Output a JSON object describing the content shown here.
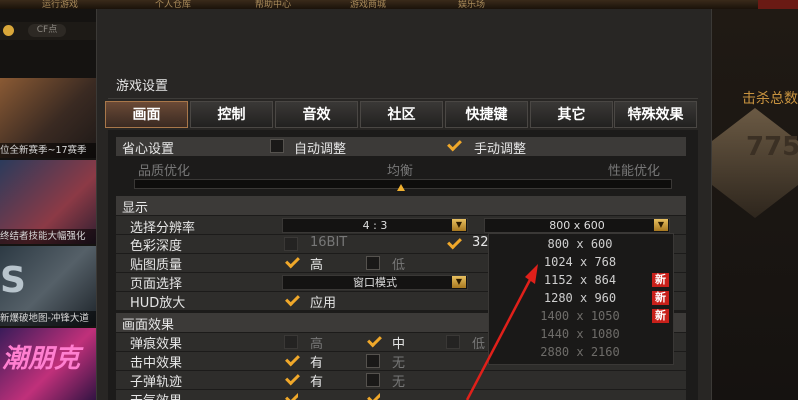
{
  "colors": {
    "accent": "#f0a82a",
    "new_badge": "#c8201a",
    "arrow": "#e0201a"
  },
  "background": {
    "top_menu": [
      "运行游戏",
      "个人仓库",
      "帮助中心",
      "游戏商城",
      "娱乐场"
    ],
    "cf_points": "CF点",
    "promos": [
      "位全新赛季~17赛季",
      "终结者技能大幅强化",
      "新爆破地图-冲锋大道",
      "",
      "潮朋克"
    ],
    "promo_big_text": "潮朋克",
    "promo_s_text": "S",
    "kill_title": "击杀总数",
    "kill_value": "775"
  },
  "dialog": {
    "title": "游戏设置",
    "tabs": [
      "画面",
      "控制",
      "音效",
      "社区",
      "快捷键",
      "其它",
      "特殊效果"
    ],
    "sections": {
      "worry_free": "省心设置",
      "display": "显示",
      "effects": "画面效果"
    },
    "worry_free": {
      "auto_label": "自动调整",
      "manual_label": "手动调整",
      "quality_label": "品质优化",
      "balance_label": "均衡",
      "performance_label": "性能优化"
    },
    "display": {
      "resolution_label": "选择分辨率",
      "aspect_value": "4 : 3",
      "resolution_value": "800 x 600",
      "color_depth_label": "色彩深度",
      "color_16": "16BIT",
      "color_32": "32",
      "texture_label": "贴图质量",
      "texture_high": "高",
      "texture_low": "低",
      "page_label": "页面选择",
      "page_value": "窗口模式",
      "hud_label": "HUD放大",
      "hud_apply": "应用"
    },
    "effects": {
      "bullet_hole_label": "弹痕效果",
      "high": "高",
      "mid": "中",
      "low": "低",
      "hit_label": "击中效果",
      "trail_label": "子弹轨迹",
      "weather_label": "天气效果",
      "yes": "有",
      "no": "无"
    },
    "resolution_options": [
      {
        "value": "800 x 600",
        "new": ""
      },
      {
        "value": "1024 x 768",
        "new": ""
      },
      {
        "value": "1152 x 864",
        "new": "新"
      },
      {
        "value": "1280 x 960",
        "new": "新"
      },
      {
        "value": "1400 x 1050",
        "new": "新"
      },
      {
        "value": "1440 x 1080",
        "new": ""
      },
      {
        "value": "2880 x 2160",
        "new": ""
      }
    ]
  }
}
